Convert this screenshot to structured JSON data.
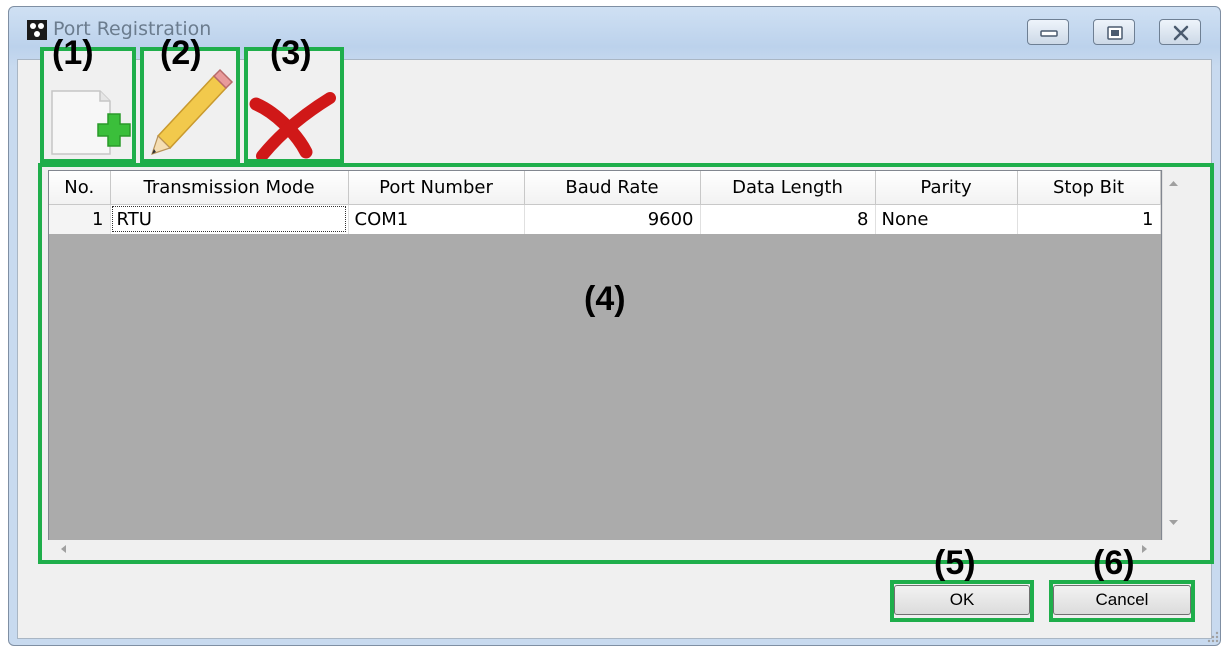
{
  "window": {
    "title": "Port Registration"
  },
  "toolbar": {
    "add_icon": "new-document-plus-icon",
    "edit_icon": "pencil-icon",
    "delete_icon": "red-x-icon"
  },
  "callouts": {
    "c1": "(1)",
    "c2": "(2)",
    "c3": "(3)",
    "c4": "(4)",
    "c5": "(5)",
    "c6": "(6)"
  },
  "grid": {
    "columns": [
      "No.",
      "Transmission Mode",
      "Port Number",
      "Baud Rate",
      "Data Length",
      "Parity",
      "Stop Bit"
    ],
    "rows": [
      [
        "1",
        "RTU",
        "COM1",
        "9600",
        "8",
        "None",
        "1"
      ]
    ]
  },
  "buttons": {
    "ok": "OK",
    "cancel": "Cancel"
  },
  "colors": {
    "callout_border": "#1fae4b",
    "grid_background": "#ababab"
  }
}
